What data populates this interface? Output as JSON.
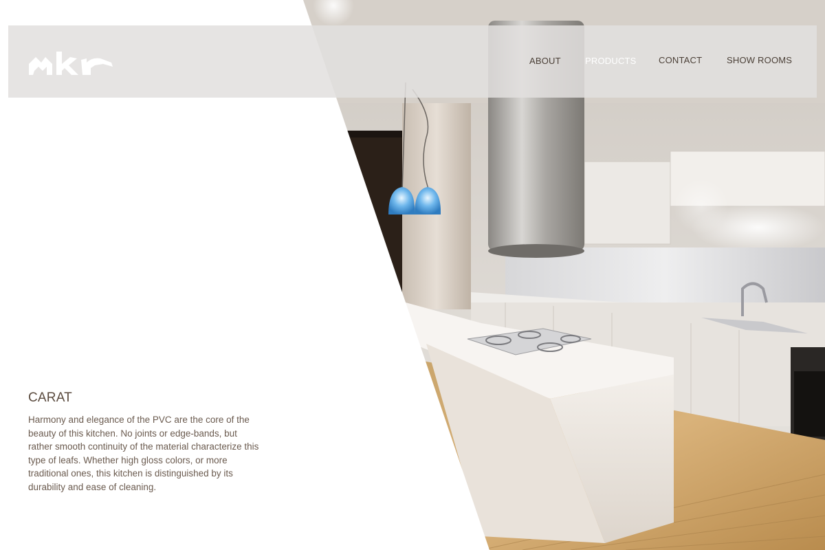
{
  "brand": {
    "logo_text": "mkr"
  },
  "nav": {
    "items": [
      {
        "label": "ABOUT",
        "active": false
      },
      {
        "label": "PRODUCTS",
        "active": true
      },
      {
        "label": "CONTACT",
        "active": false
      },
      {
        "label": "SHOW ROOMS",
        "active": false
      }
    ]
  },
  "product": {
    "title": "CARAT",
    "description": "Harmony and elegance of the PVC are the core of the beauty of this kitchen. No joints or edge-bands, but rather smooth continuity of the material characterize this type of leafs. Whether high gloss colors, or more traditional ones, this kitchen is distinguished by its durability and ease of cleaning."
  },
  "colors": {
    "header_bg": "#e2e0de",
    "nav_text": "#4a3f36",
    "nav_active": "#ffffff",
    "text_brown": "#5a4a3e"
  },
  "icons": {
    "logo": "mkr-logo"
  }
}
